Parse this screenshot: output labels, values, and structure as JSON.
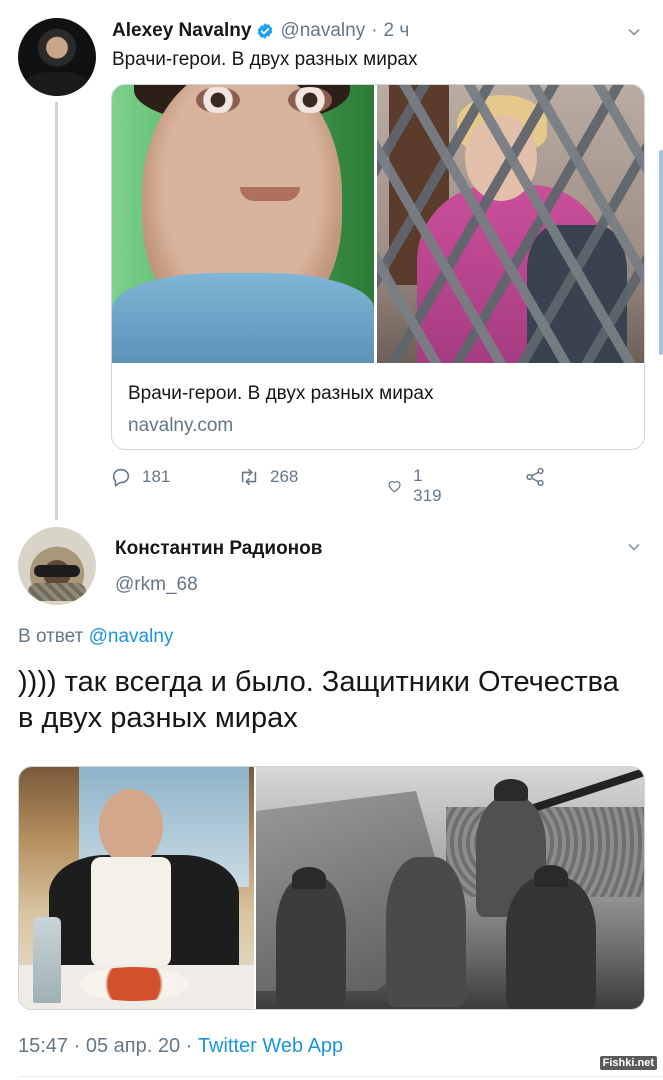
{
  "tweet1": {
    "author_name": "Alexey Navalny",
    "handle": "@navalny",
    "separator": "·",
    "time": "2 ч",
    "text": "Врачи-герои. В двух разных мирах",
    "card": {
      "title": "Врачи-герои. В двух разных мирах",
      "domain": "navalny.com"
    },
    "actions": {
      "reply_count": "181",
      "retweet_count": "268",
      "like_count": "1 319"
    }
  },
  "tweet2": {
    "author_name": "Константин Радионов",
    "handle": "@rkm_68",
    "reply_prefix": "В ответ",
    "reply_mention": "@navalny",
    "text": ")))) так всегда и было. Защитники Отечества в двух разных мирах",
    "time": "15:47",
    "date": "05 апр. 20",
    "separator": "·",
    "source": "Twitter Web App"
  },
  "watermark": "Fishki.net",
  "colors": {
    "link": "#1b95e0",
    "secondary_text": "#657786",
    "verified": "#1da1f2",
    "border": "#ccd6dd"
  },
  "icons": [
    "verified-badge-icon",
    "chevron-down-icon",
    "reply-icon",
    "retweet-icon",
    "like-icon",
    "share-icon"
  ]
}
